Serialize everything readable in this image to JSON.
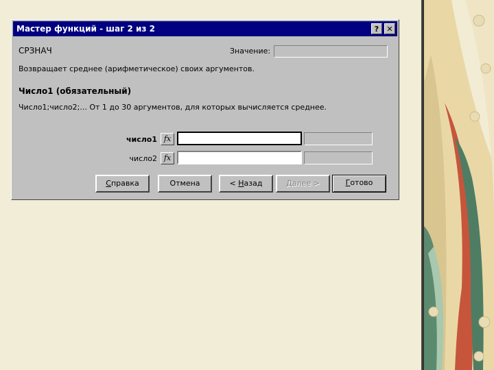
{
  "dialog": {
    "title": "Мастер функций - шаг 2 из 2",
    "help_glyph": "?",
    "close_glyph": "✕",
    "function_name": "СРЗНАЧ",
    "value_label": "Значение:",
    "description": "Возвращает среднее (арифметическое) своих аргументов.",
    "argument_title": "Число1 (обязательный)",
    "argument_description": "Число1;число2;... От 1 до 30 аргументов, для которых вычисляется среднее.",
    "args": [
      {
        "label": "число1",
        "fx": "fx",
        "value": ""
      },
      {
        "label": "число2",
        "fx": "fx",
        "value": ""
      }
    ],
    "buttons": {
      "help": {
        "mnemonic": "С",
        "rest": "правка"
      },
      "cancel": "Отмена",
      "back": {
        "prefix": "< ",
        "mnemonic": "Н",
        "rest": "азад"
      },
      "next": {
        "mnemonic": "Д",
        "rest": "алее >"
      },
      "finish": {
        "mnemonic": "Г",
        "rest": "отово"
      }
    }
  },
  "colors": {
    "titlebar": "#000080",
    "dialog_face": "#c0c0c0",
    "slide_background": "#f1edd6"
  }
}
